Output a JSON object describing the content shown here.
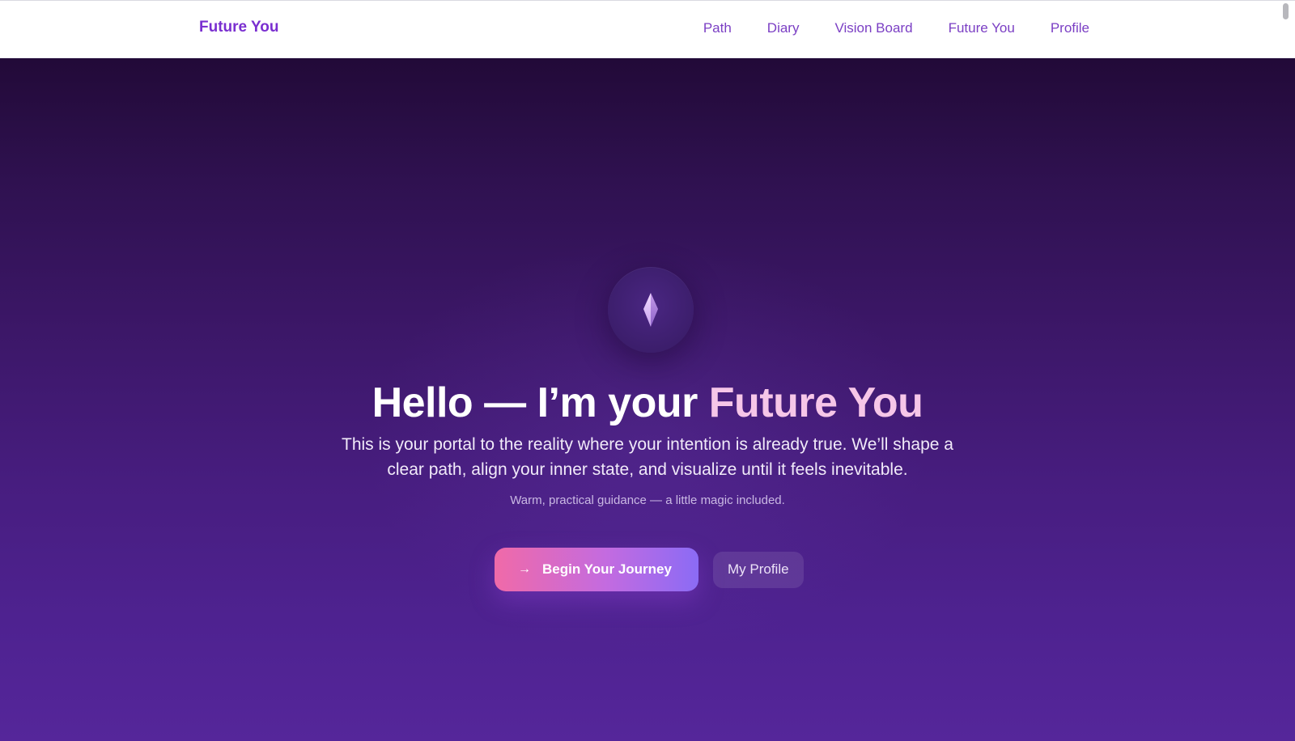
{
  "header": {
    "brand": "Future You",
    "nav": [
      {
        "label": "Path"
      },
      {
        "label": "Diary"
      },
      {
        "label": "Vision Board"
      },
      {
        "label": "Future You"
      },
      {
        "label": "Profile"
      }
    ]
  },
  "hero": {
    "icon": "crystal-icon",
    "headline_prefix": "Hello — I’m your ",
    "headline_accent": "Future You",
    "subtext": "This is your portal to the reality where your intention is already true. We’ll shape a clear path, align your inner state, and visualize until it feels inevitable.",
    "tagline": "Warm, practical guidance — a little magic included.",
    "primary_cta": {
      "icon": "arrow-right-icon",
      "arrow": "→",
      "label": "Begin Your Journey"
    },
    "secondary_cta": {
      "label": "My Profile"
    }
  },
  "colors": {
    "brand": "#7a2fd0",
    "nav_link": "#7b3fc4",
    "accent_text": "#f6c6e8",
    "hero_top": "#220a38",
    "hero_bottom": "#55269a",
    "cta_gradient_start": "#f06aa8",
    "cta_gradient_end": "#8b6bf5"
  }
}
